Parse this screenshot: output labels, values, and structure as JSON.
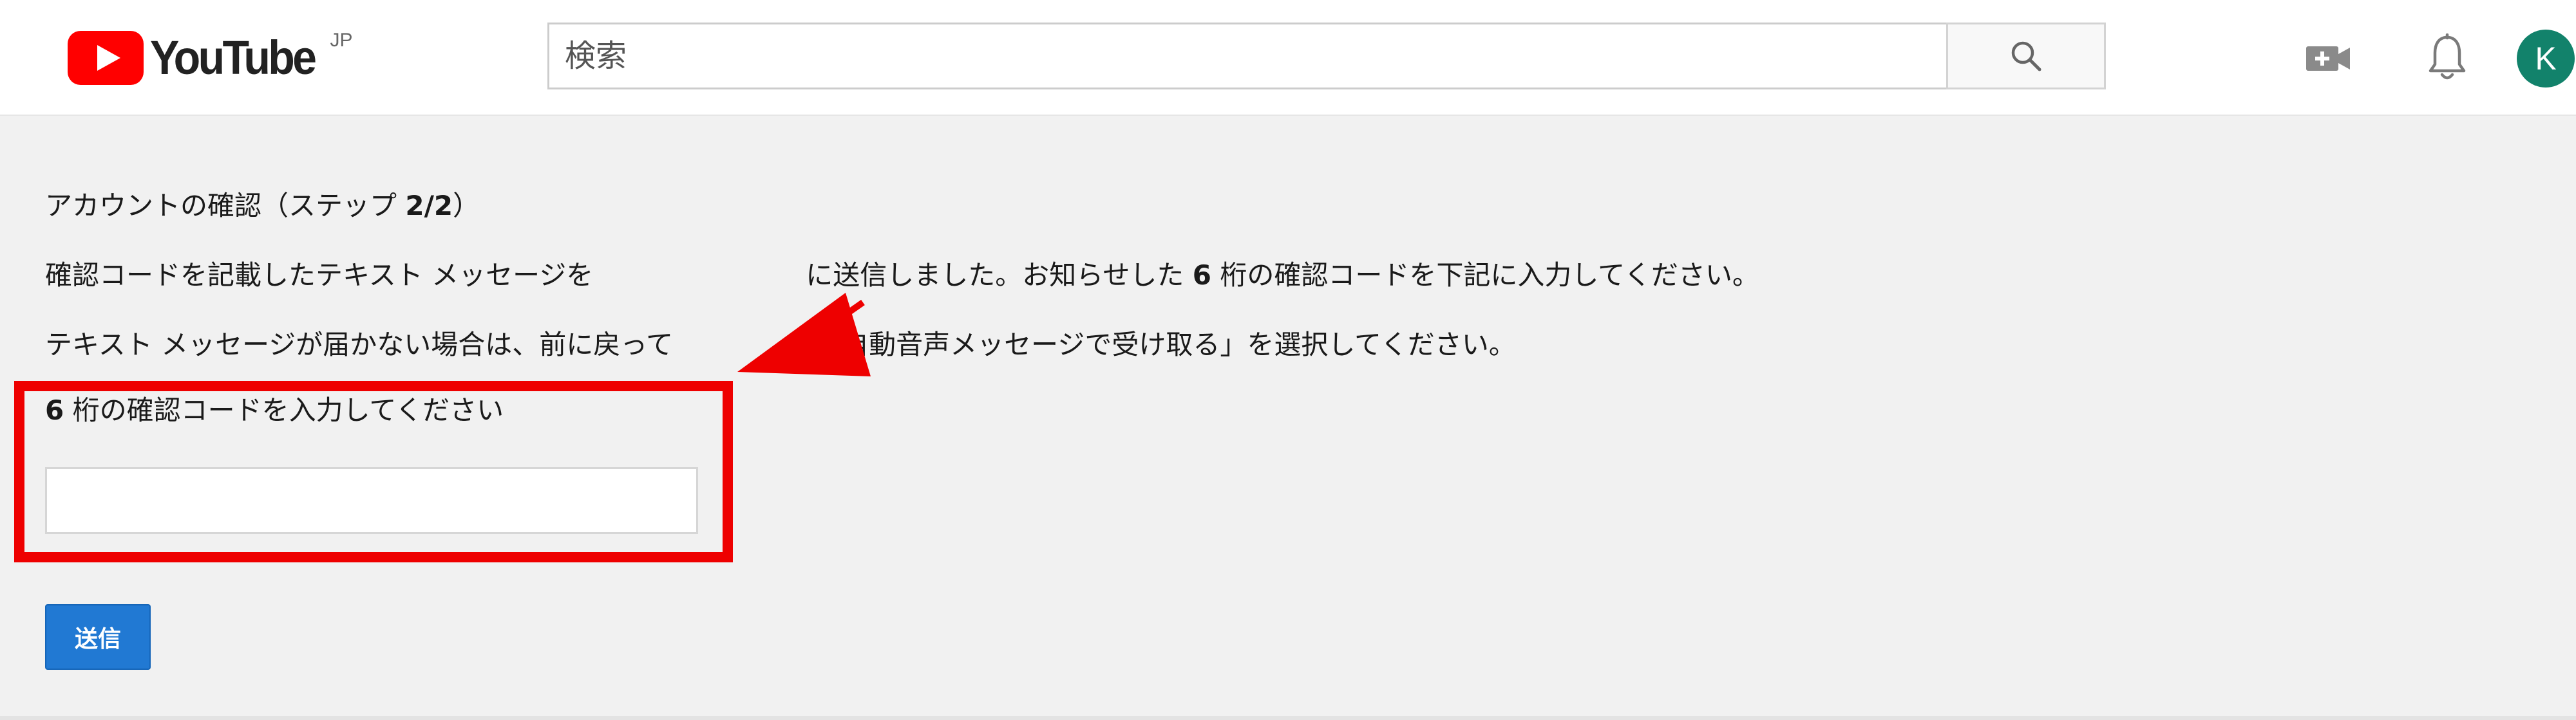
{
  "header": {
    "logo_text": "YouTube",
    "logo_region": "JP",
    "search_placeholder": "検索",
    "icons": {
      "search": "search-icon",
      "upload": "video-camera-plus-icon",
      "notifications": "bell-icon"
    },
    "avatar_letter": "K",
    "avatar_color": "#12826b",
    "brand_red": "#ff0000"
  },
  "verify": {
    "heading_prefix": "アカウントの確認（ステップ ",
    "heading_step": "2/2",
    "heading_suffix": "）",
    "line1_part1": "確認コードを記載したテキスト メッセージを",
    "line1_part2": "に送信しました。お知らせした",
    "line1_digits": "6",
    "line1_part3": "桁の確認コードを下記に入力してください。",
    "line2_part1": "テキスト メッセージが届かない場合は、前に戻って",
    "line2_part2": "の自動音声メッセージで受け取る」を選択してください。",
    "field_label_digits": "6",
    "field_label_text": "桁の確認コードを入力してください",
    "code_value": "",
    "submit_label": "送信"
  },
  "annotation": {
    "color": "#ee0000"
  }
}
